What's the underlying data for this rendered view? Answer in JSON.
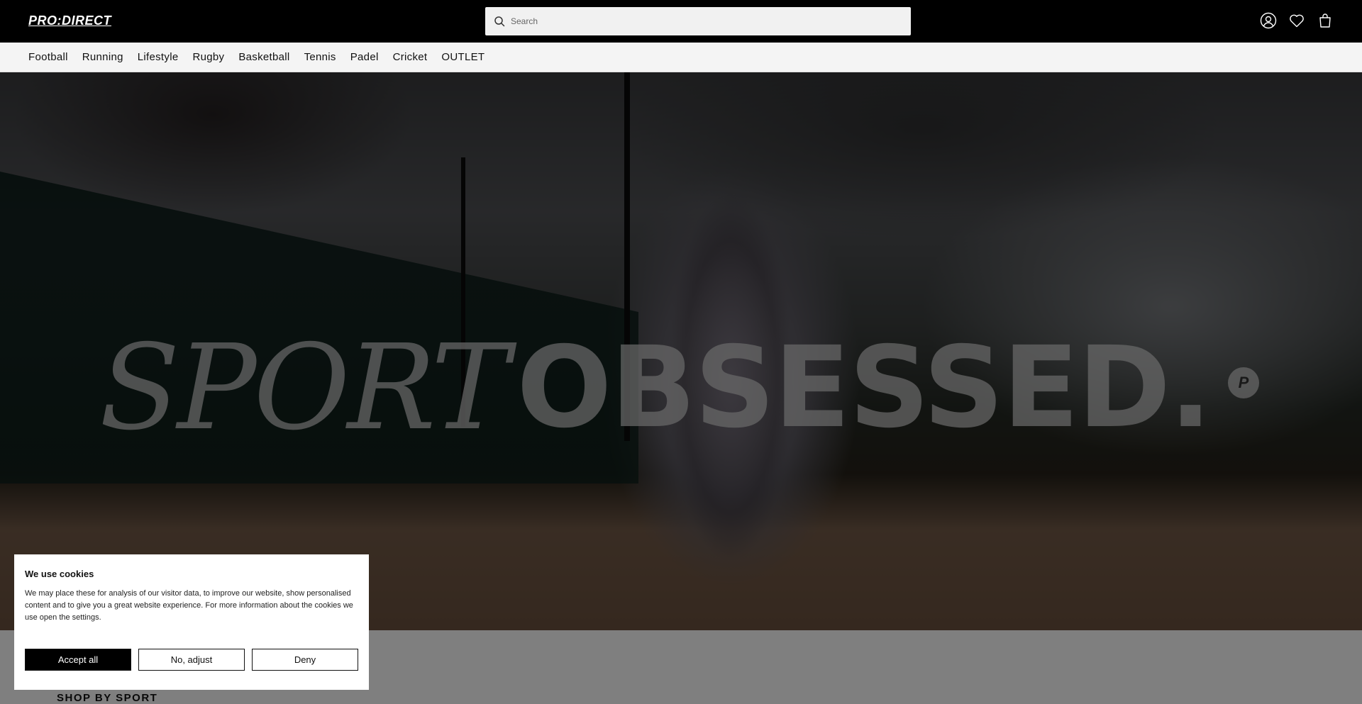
{
  "header": {
    "logo_text": "PRO:DIRECT",
    "search_placeholder": "Search",
    "icons": [
      "account-icon",
      "wishlist-heart-icon",
      "bag-icon"
    ]
  },
  "nav": {
    "items": [
      "Football",
      "Running",
      "Lifestyle",
      "Rugby",
      "Basketball",
      "Tennis",
      "Padel",
      "Cricket",
      "OUTLET"
    ]
  },
  "hero": {
    "title_serif": "SPORT",
    "title_sans": "OBSESSED.",
    "badge_text": "P"
  },
  "section": {
    "heading": "SHOP BY SPORT"
  },
  "cookie": {
    "title": "We use cookies",
    "body": "We may place these for analysis of our visitor data, to improve our website, show personalised content and to give you a great website experience. For more information about the cookies we use open the settings.",
    "accept_label": "Accept all",
    "adjust_label": "No, adjust",
    "deny_label": "Deny"
  },
  "colors": {
    "header_bg": "#000000",
    "nav_bg": "#f4f4f4",
    "accept_bg": "#000000"
  }
}
